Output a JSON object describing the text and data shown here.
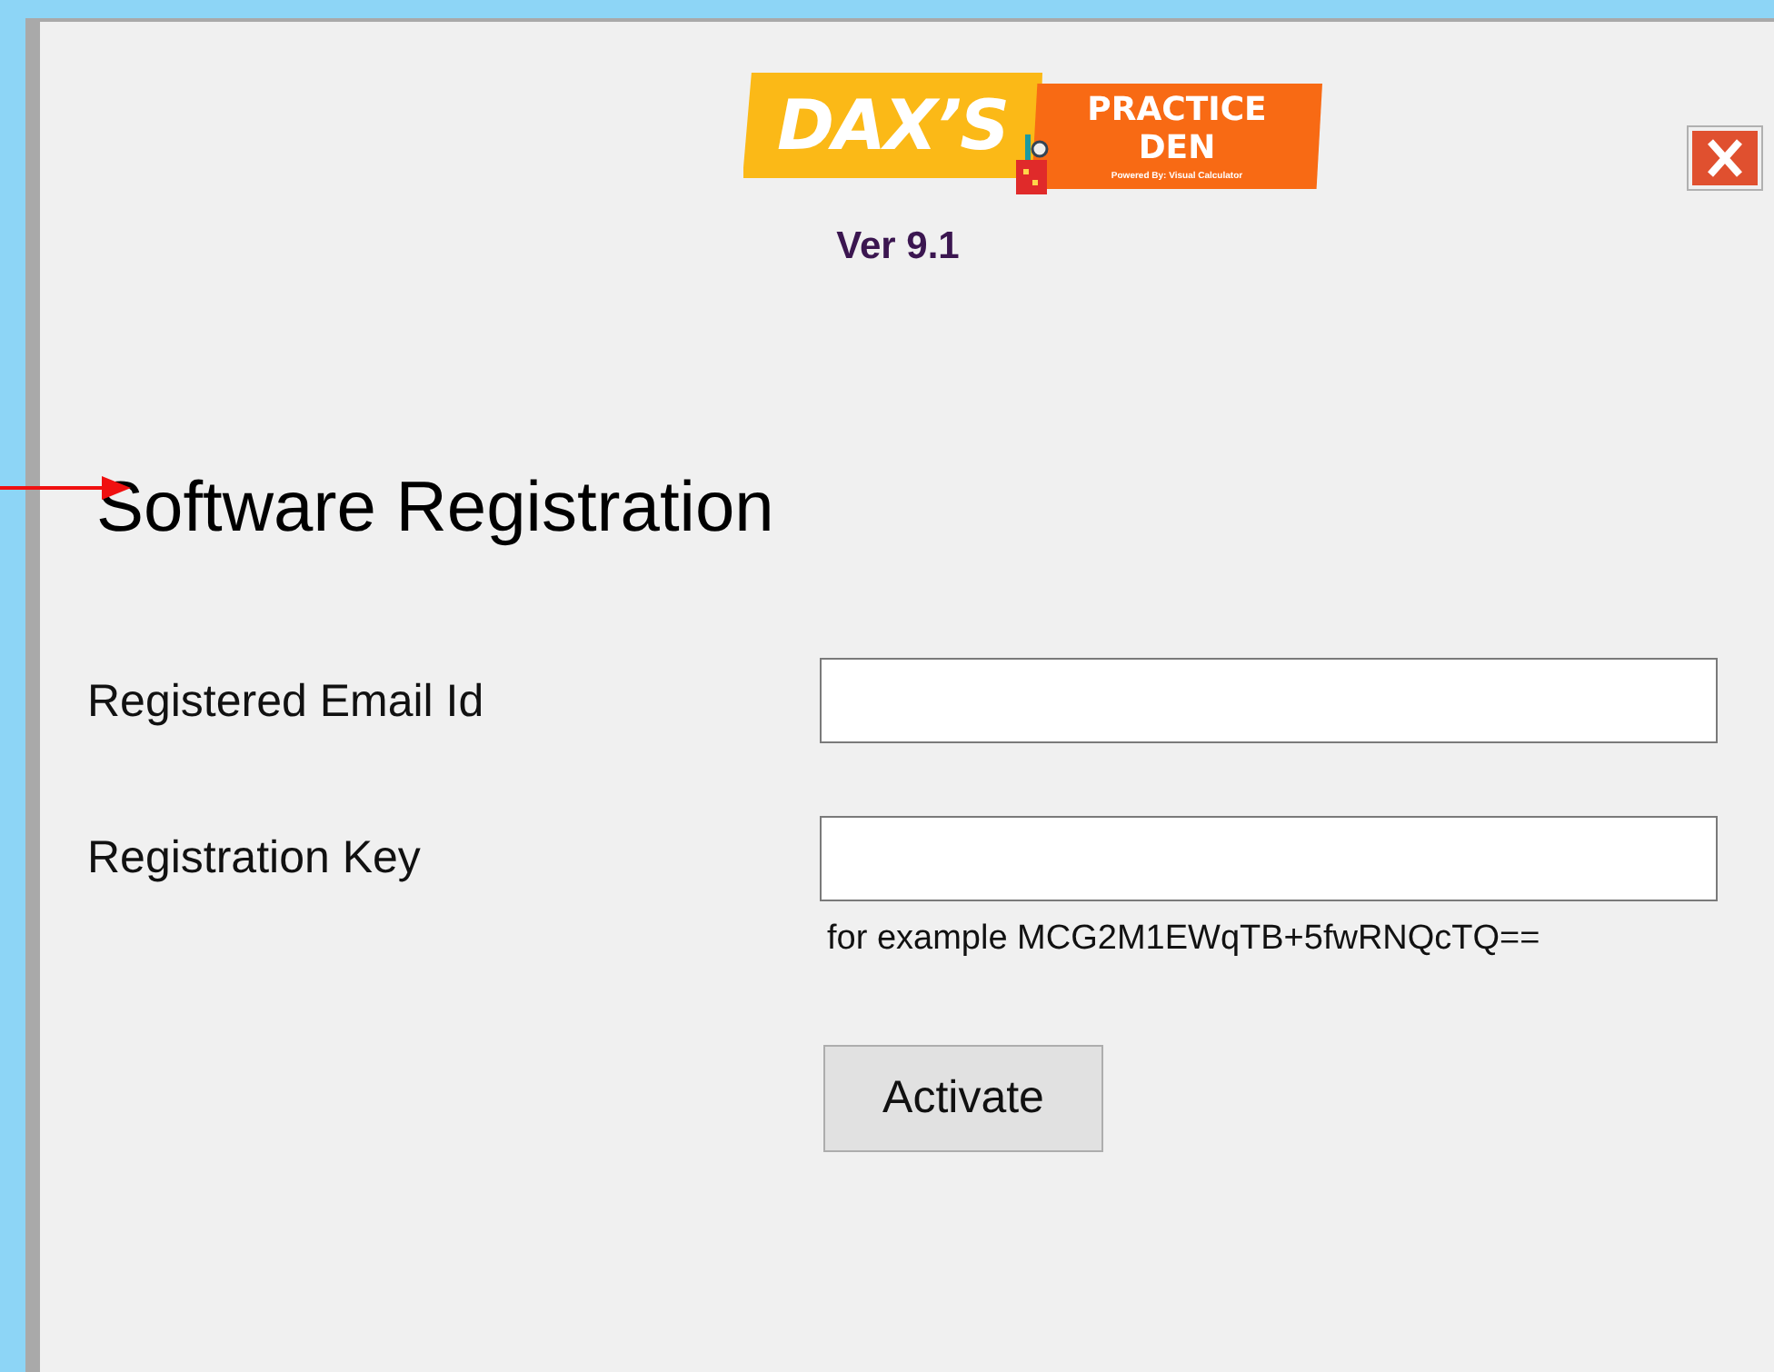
{
  "logo": {
    "brand": "DAX’S",
    "product_line1": "PRACTICE",
    "product_line2": "DEN",
    "tagline": "Powered By: Visual Calculator"
  },
  "version": "Ver 9.1",
  "heading": "Software Registration",
  "fields": [
    {
      "label": "Registered Email Id"
    },
    {
      "label": "Registration Key",
      "hint": "for example MCG2M1EWqTB+5fwRNQcTQ=="
    }
  ],
  "buttons": [
    "Activate"
  ]
}
